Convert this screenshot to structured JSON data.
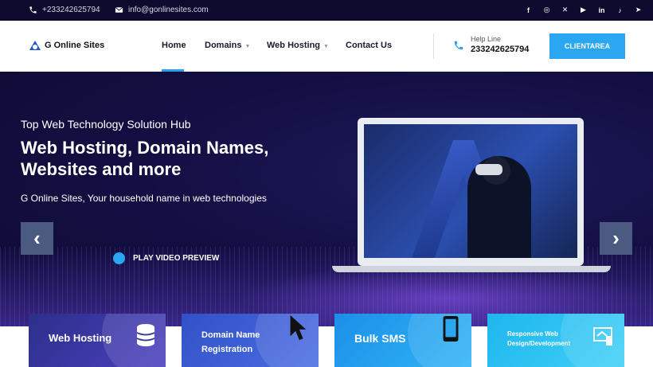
{
  "topbar": {
    "phone": "+233242625794",
    "email": "info@gonlinesites.com",
    "socials": [
      "facebook-icon",
      "instagram-icon",
      "x-icon",
      "youtube-icon",
      "linkedin-icon",
      "tiktok-icon",
      "telegram-icon"
    ]
  },
  "nav": {
    "logo_text": "G Online Sites",
    "items": [
      {
        "label": "Home"
      },
      {
        "label": "Domains"
      },
      {
        "label": "Web Hosting"
      },
      {
        "label": "Contact Us"
      }
    ],
    "help_label": "Help Line",
    "help_number": "233242625794",
    "client_button": "CLIENTAREA"
  },
  "hero": {
    "kicker": "Top Web Technology Solution Hub",
    "headline": "Web Hosting, Domain Names, Websites and more",
    "subtitle": "G Online Sites, Your household name in web technologies",
    "play_label": "PLAY VIDEO PREVIEW",
    "prev": "‹",
    "next": "›"
  },
  "cards": [
    {
      "label": "Web Hosting",
      "color": "#3a3f9e"
    },
    {
      "label": "Domain Name Registration",
      "color": "#3b5bd6"
    },
    {
      "label": "Bulk SMS",
      "color": "#2aa7f0"
    },
    {
      "label": "Responsive Web Design/Development",
      "color": "#27c3f0"
    }
  ]
}
